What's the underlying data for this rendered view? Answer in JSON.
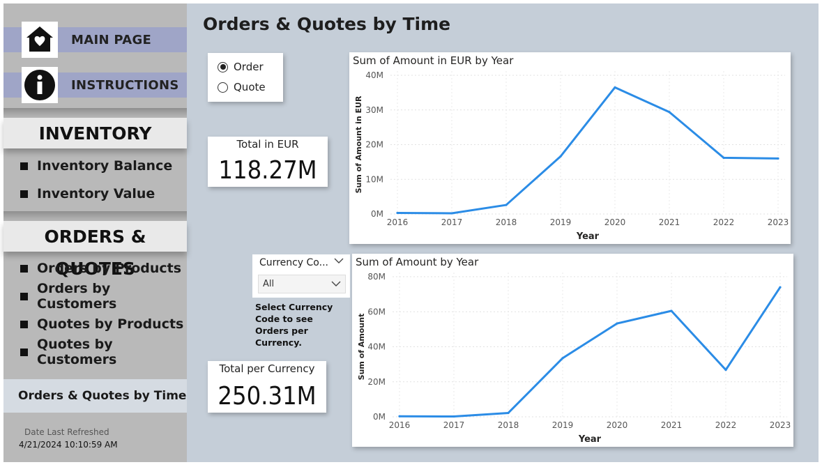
{
  "sidebar": {
    "main_page": "MAIN PAGE",
    "instructions": "INSTRUCTIONS",
    "inventory_header": "INVENTORY",
    "inventory_items": [
      "Inventory Balance",
      "Inventory Value"
    ],
    "orders_header": "ORDERS & QUOTES",
    "orders_items": [
      "Orders by Products",
      "Orders by Customers",
      "Quotes by Products",
      "Quotes by Customers"
    ],
    "active_page": "Orders & Quotes by Time",
    "refresh_label": "Date Last Refreshed",
    "refresh_value": "4/21/2024 10:10:59 AM"
  },
  "page_title": "Orders & Quotes by Time",
  "toggle": {
    "options": [
      "Order",
      "Quote"
    ],
    "selected": "Order"
  },
  "kpi_eur": {
    "label": "Total in EUR",
    "value": "118.27M"
  },
  "kpi_currency": {
    "label": "Total per Currency",
    "value": "250.31M"
  },
  "slicer": {
    "title": "Currency Co...",
    "value": "All",
    "note": "Select Currency Code to see Orders per Currency."
  },
  "colors": {
    "line": "#2b8ce6",
    "sidebar": "#b9b9b9",
    "nav_button": "#9fa5c7",
    "background": "#c5ced8"
  },
  "chart_data": [
    {
      "type": "line",
      "title": "Sum of Amount in EUR by Year",
      "xlabel": "Year",
      "ylabel": "Sum of Amount in EUR",
      "x": [
        "2016",
        "2017",
        "2018",
        "2019",
        "2020",
        "2021",
        "2022",
        "2023"
      ],
      "values": [
        0.3,
        0.2,
        2.6,
        16.6,
        36.5,
        29.4,
        16.2,
        16.0
      ],
      "unit": "M",
      "ylim": [
        0,
        40
      ],
      "yticks": [
        "0M",
        "10M",
        "20M",
        "30M",
        "40M"
      ],
      "grid": true
    },
    {
      "type": "line",
      "title": "Sum of Amount by Year",
      "xlabel": "Year",
      "ylabel": "Sum of Amount",
      "x": [
        "2016",
        "2017",
        "2018",
        "2019",
        "2020",
        "2021",
        "2022",
        "2023"
      ],
      "values": [
        0.3,
        0.2,
        2.2,
        33.5,
        53.3,
        60.5,
        26.8,
        74.0
      ],
      "unit": "M",
      "ylim": [
        0,
        80
      ],
      "yticks": [
        "0M",
        "20M",
        "40M",
        "60M",
        "80M"
      ],
      "grid": true
    }
  ]
}
